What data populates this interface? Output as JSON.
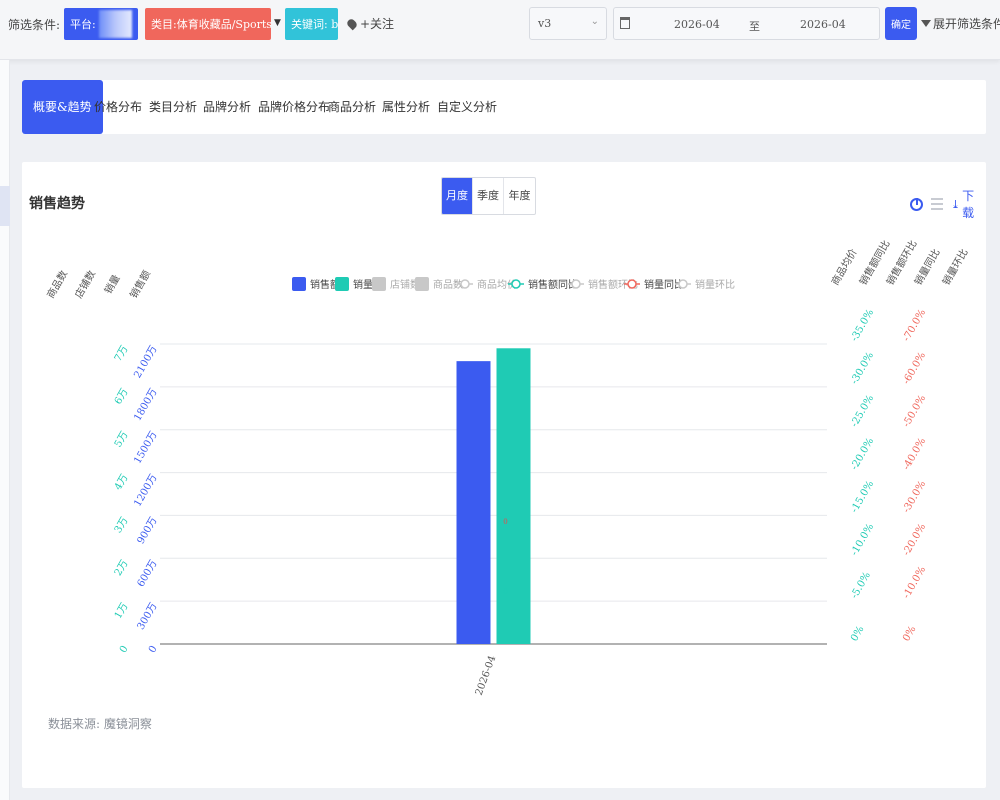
{
  "filter": {
    "label": "筛选条件:",
    "platform_label": "平台:",
    "category_label": "类目:体育收藏品/Sports Collectibles",
    "keyword_label": "关键词: ball",
    "follow_label": "+关注",
    "version_value": "v3",
    "date_start": "2026-04",
    "date_to": "至",
    "date_end": "2026-04",
    "confirm_label": "确定",
    "expand_label": "展开筛选条件"
  },
  "tabs": [
    {
      "label": "概要&趋势",
      "active": true
    },
    {
      "label": "价格分布"
    },
    {
      "label": "类目分析"
    },
    {
      "label": "品牌分析"
    },
    {
      "label": "品牌价格分布"
    },
    {
      "label": "商品分析"
    },
    {
      "label": "属性分析"
    },
    {
      "label": "自定义分析"
    }
  ],
  "panel": {
    "title": "销售趋势",
    "period_options": [
      "月度",
      "季度",
      "年度"
    ],
    "active_period": "月度",
    "download_label": "下载",
    "source_label": "数据来源: 魔镜洞察"
  },
  "colors": {
    "primary": "#3b5bf0",
    "teal": "#1fcbb4",
    "red": "#f0675c",
    "keyword_tag": "#31c3d9",
    "inactive": "#c8c8c8"
  },
  "chart_data": {
    "type": "bar",
    "categories": [
      "2026-04"
    ],
    "series": [
      {
        "name": "销售额",
        "axis": "销售额",
        "values": [
          19800000
        ],
        "color": "#3b5bf0",
        "enabled": true,
        "kind": "bar"
      },
      {
        "name": "销量",
        "axis": "销量",
        "values": [
          69000
        ],
        "color": "#1fcbb4",
        "enabled": true,
        "kind": "bar"
      },
      {
        "name": "店铺数",
        "kind": "bar",
        "enabled": false
      },
      {
        "name": "商品数",
        "kind": "bar",
        "enabled": false
      },
      {
        "name": "商品均价",
        "kind": "line",
        "enabled": false
      },
      {
        "name": "销售额同比",
        "kind": "line",
        "enabled": true,
        "color": "#1fcbb4"
      },
      {
        "name": "销售额环比",
        "kind": "line",
        "enabled": false
      },
      {
        "name": "销量同比",
        "kind": "line",
        "enabled": true,
        "color": "#f0675c"
      },
      {
        "name": "销量环比",
        "kind": "line",
        "enabled": false
      }
    ],
    "point_labels": [
      "0",
      "0"
    ],
    "left_axes": [
      {
        "title": "商品数",
        "ticks": []
      },
      {
        "title": "店铺数",
        "ticks": []
      },
      {
        "title": "销量",
        "color": "#1fcbb4",
        "range": [
          0,
          70000
        ],
        "ticks": [
          "0",
          "1万",
          "2万",
          "3万",
          "4万",
          "5万",
          "6万",
          "7万"
        ]
      },
      {
        "title": "销售额",
        "color": "#3b5bf0",
        "range": [
          0,
          21000000
        ],
        "ticks": [
          "0",
          "300万",
          "600万",
          "900万",
          "1200万",
          "1500万",
          "1800万",
          "2100万"
        ]
      }
    ],
    "right_axes": [
      {
        "title": "商品均价",
        "ticks": []
      },
      {
        "title": "销售额同比",
        "color": "#1fcbb4",
        "ticks": [
          "0%",
          "-5.0%",
          "-10.0%",
          "-15.0%",
          "-20.0%",
          "-25.0%",
          "-30.0%",
          "-35.0%"
        ]
      },
      {
        "title": "销售额环比",
        "ticks": []
      },
      {
        "title": "销量同比",
        "color": "#f0675c",
        "ticks": [
          "0%",
          "-10.0%",
          "-20.0%",
          "-30.0%",
          "-40.0%",
          "-50.0%",
          "-60.0%",
          "-70.0%"
        ]
      },
      {
        "title": "销量环比",
        "ticks": []
      }
    ],
    "legend_position": "top",
    "grid": true
  }
}
